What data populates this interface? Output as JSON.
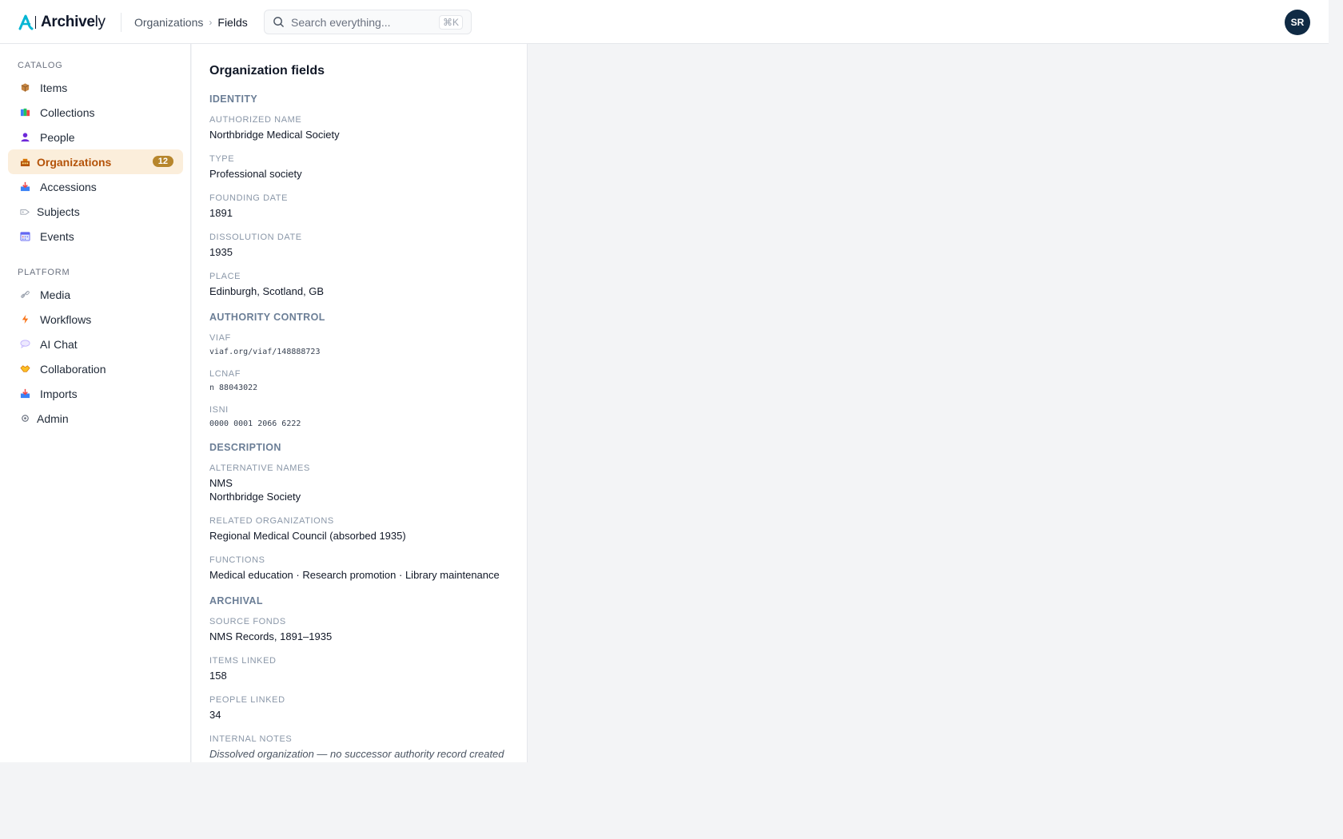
{
  "brand": {
    "name_bold": "Archive",
    "name_suffix": "ly",
    "logo_color": "#06b6d4"
  },
  "breadcrumb": {
    "parent": "Organizations",
    "separator": "›",
    "current": "Fields"
  },
  "search": {
    "placeholder": "Search everything...",
    "shortcut": "⌘K"
  },
  "user": {
    "initials": "SR"
  },
  "sidebar": {
    "catalog_label": "CATALOG",
    "catalog_items": [
      {
        "label": "Items",
        "icon": "package-icon"
      },
      {
        "label": "Collections",
        "icon": "books-icon"
      },
      {
        "label": "People",
        "icon": "person-icon"
      },
      {
        "label": "Organizations",
        "icon": "building-icon",
        "active": true,
        "badge": "12"
      },
      {
        "label": "Accessions",
        "icon": "inbox-icon"
      },
      {
        "label": "Subjects",
        "icon": "tag-icon"
      },
      {
        "label": "Events",
        "icon": "calendar-icon"
      }
    ],
    "platform_label": "PLATFORM",
    "platform_items": [
      {
        "label": "Media",
        "icon": "link-icon"
      },
      {
        "label": "Workflows",
        "icon": "bolt-icon"
      },
      {
        "label": "AI Chat",
        "icon": "speech-bubble-icon"
      },
      {
        "label": "Collaboration",
        "icon": "handshake-icon"
      },
      {
        "label": "Imports",
        "icon": "inbox-tray-icon"
      },
      {
        "label": "Admin",
        "icon": "gear-icon"
      }
    ]
  },
  "panel": {
    "title": "Organization fields",
    "identity": {
      "title": "IDENTITY",
      "authorized_name_label": "AUTHORIZED NAME",
      "authorized_name": "Northbridge Medical Society",
      "type_label": "TYPE",
      "type": "Professional society",
      "founding_label": "FOUNDING DATE",
      "founding": "1891",
      "dissolution_label": "DISSOLUTION DATE",
      "dissolution": "1935",
      "place_label": "PLACE",
      "place": "Edinburgh, Scotland, GB"
    },
    "authority": {
      "title": "AUTHORITY CONTROL",
      "viaf_label": "VIAF",
      "viaf": "viaf.org/viaf/148888723",
      "lcnaf_label": "LCNAF",
      "lcnaf": "n 88043022",
      "isni_label": "ISNI",
      "isni": "0000 0001 2066 6222"
    },
    "description": {
      "title": "DESCRIPTION",
      "alt_names_label": "ALTERNATIVE NAMES",
      "alt_names": [
        "NMS",
        "Northbridge Society"
      ],
      "related_label": "RELATED ORGANIZATIONS",
      "related": "Regional Medical Council (absorbed 1935)",
      "functions_label": "FUNCTIONS",
      "functions": "Medical education · Research promotion · Library maintenance"
    },
    "archival": {
      "title": "ARCHIVAL",
      "source_label": "SOURCE FONDS",
      "source": "NMS Records, 1891–1935",
      "items_label": "ITEMS LINKED",
      "items": "158",
      "people_label": "PEOPLE LINKED",
      "people": "34",
      "notes_label": "INTERNAL NOTES",
      "notes": "Dissolved organization — no successor authority record created"
    }
  }
}
